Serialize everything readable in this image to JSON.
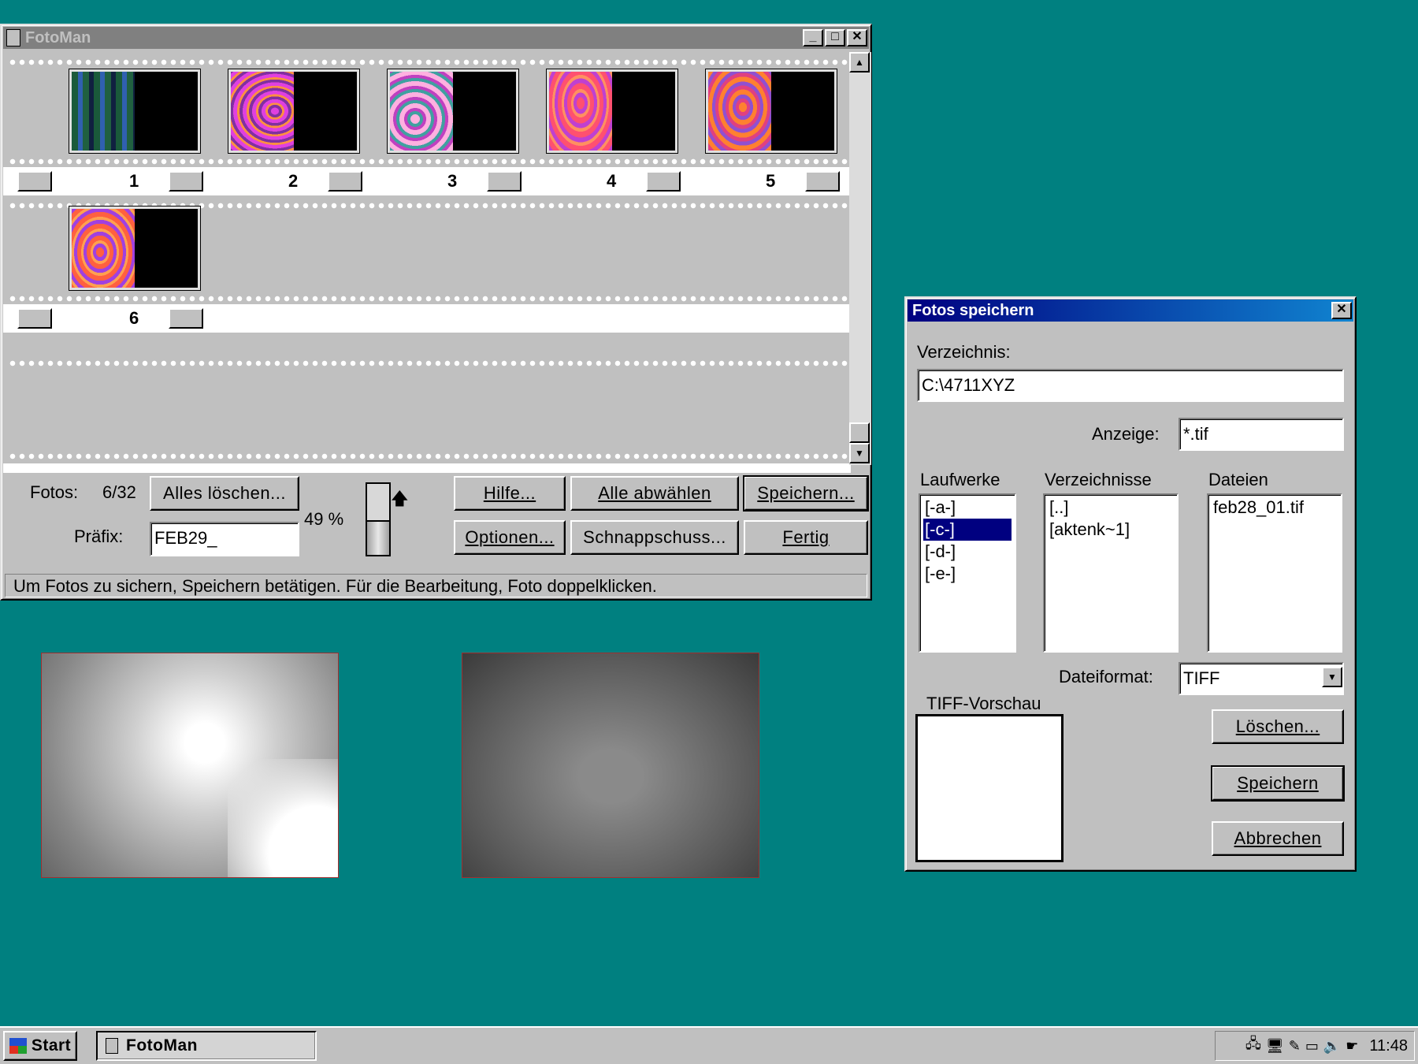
{
  "fotoman": {
    "title": "FotoMan",
    "frames": [
      {
        "number": "1"
      },
      {
        "number": "2"
      },
      {
        "number": "3"
      },
      {
        "number": "4"
      },
      {
        "number": "5"
      },
      {
        "number": "6"
      }
    ],
    "photos_label": "Fotos:",
    "photos_count": "6/32",
    "clear_all": "Alles löschen...",
    "prefix_label": "Präfix:",
    "prefix_value": "FEB29_",
    "battery_percent": "49 %",
    "battery_level": 0.49,
    "help": "Hilfe...",
    "deselect_all": "Alle abwählen",
    "save": "Speichern...",
    "options": "Optionen...",
    "snapshot": "Schnappschuss...",
    "done": "Fertig",
    "status": "Um Fotos zu sichern, Speichern betätigen. Für die Bearbeitung, Foto doppelklicken."
  },
  "dialog": {
    "title": "Fotos speichern",
    "directory_label": "Verzeichnis:",
    "directory_value": "C:\\4711XYZ",
    "filter_label": "Anzeige:",
    "filter_value": "*.tif",
    "drives_label": "Laufwerke",
    "drives": [
      "[-a-]",
      "[-c-]",
      "[-d-]",
      "[-e-]"
    ],
    "selected_drive": "[-c-]",
    "dirs_label": "Verzeichnisse",
    "dirs": [
      "[..]",
      "[aktenk~1]"
    ],
    "files_label": "Dateien",
    "files": [
      "feb28_01.tif"
    ],
    "format_label": "Dateiformat:",
    "format_value": "TIFF",
    "preview_label": "TIFF-Vorschau",
    "delete": "Löschen...",
    "save": "Speichern",
    "cancel": "Abbrechen"
  },
  "taskbar": {
    "start": "Start",
    "task": "FotoMan",
    "clock": "11:48"
  }
}
